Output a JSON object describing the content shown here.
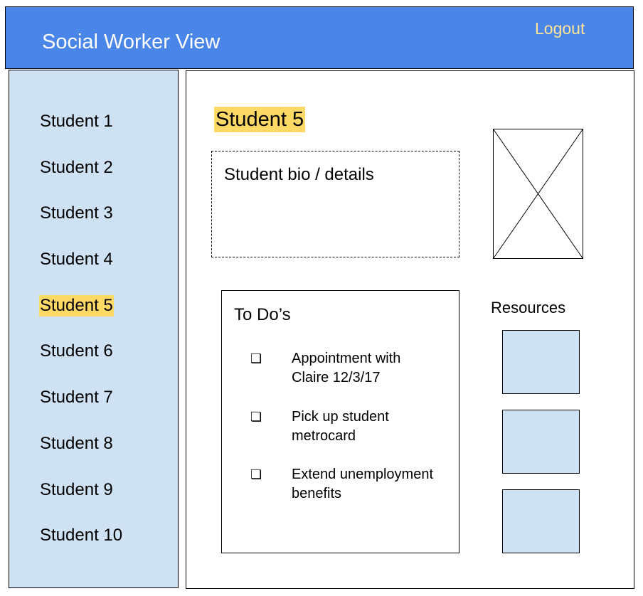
{
  "header": {
    "title": "Social Worker View",
    "logout_label": "Logout"
  },
  "sidebar": {
    "items": [
      {
        "label": "Student 1"
      },
      {
        "label": "Student 2"
      },
      {
        "label": "Student 3"
      },
      {
        "label": "Student 4"
      },
      {
        "label": "Student 5",
        "active": true
      },
      {
        "label": "Student 6"
      },
      {
        "label": "Student 7"
      },
      {
        "label": "Student 8"
      },
      {
        "label": "Student 9"
      },
      {
        "label": "Student 10"
      }
    ]
  },
  "main": {
    "student_name": "Student 5",
    "bio_label": "Student bio / details",
    "todo": {
      "title": "To Do’s",
      "checkbox_glyph": "❏",
      "items": [
        {
          "text": "Appointment with Claire 12/3/17"
        },
        {
          "text": "Pick up student metrocard"
        },
        {
          "text": "Extend unemployment benefits"
        }
      ]
    },
    "resources": {
      "label": "Resources",
      "count_boxes": 3
    }
  },
  "colors": {
    "header_bg": "#4a86e8",
    "sidebar_bg": "#cfe2f3",
    "highlight": "#ffd966",
    "logout_text": "#ffe599",
    "resource_box": "#cfe2f3"
  }
}
